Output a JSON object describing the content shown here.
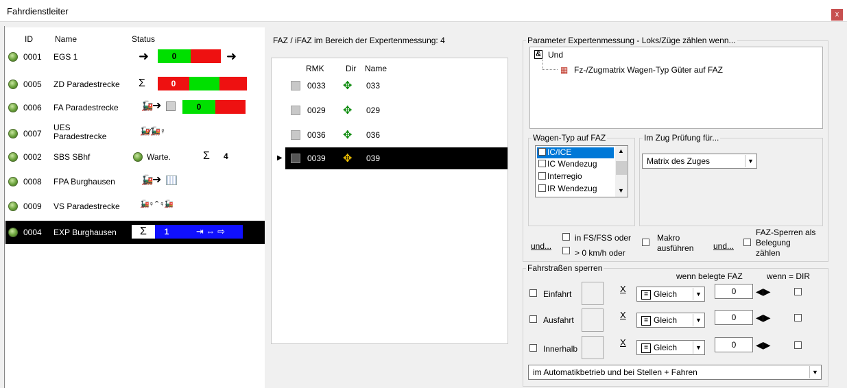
{
  "window": {
    "title": "Fahrdienstleiter",
    "close_label": "x"
  },
  "list": {
    "headers": {
      "id": "ID",
      "name": "Name",
      "status": "Status"
    },
    "rows": [
      {
        "id": "0001",
        "name": "EGS 1",
        "status_value": "0"
      },
      {
        "id": "0005",
        "name": "ZD Paradestrecke",
        "status_sym": "Σ",
        "status_value": "0"
      },
      {
        "id": "0006",
        "name": "FA Paradestrecke",
        "status_value": "0"
      },
      {
        "id": "0007",
        "name": "UES",
        "name2": "Paradestrecke"
      },
      {
        "id": "0002",
        "name": "SBS SBhf",
        "status_text": "Warte.",
        "status_sym": "Σ",
        "status_value": "4"
      },
      {
        "id": "0008",
        "name": "FPA Burghausen"
      },
      {
        "id": "0009",
        "name": "VS Paradestrecke"
      },
      {
        "id": "0004",
        "name": "EXP Burghausen",
        "status_sym": "Σ",
        "status_value": "1"
      }
    ]
  },
  "middle": {
    "header": "FAZ / iFAZ im Bereich der Expertenmessung: 4",
    "columns": {
      "rmk": "RMK",
      "dir": "Dir",
      "name": "Name"
    },
    "rows": [
      {
        "rmk": "0033",
        "name": "033"
      },
      {
        "rmk": "0029",
        "name": "029"
      },
      {
        "rmk": "0036",
        "name": "036"
      },
      {
        "rmk": "0039",
        "name": "039"
      }
    ]
  },
  "params": {
    "legend": "Parameter Expertenmessung - Loks/Züge zählen wenn...",
    "tree_root": "Und",
    "tree_child": "Fz-/Zugmatrix Wagen-Typ Güter auf FAZ"
  },
  "wagen": {
    "legend": "Wagen-Typ auf FAZ",
    "items": [
      "IC/ICE",
      "IC Wendezug",
      "Interregio",
      "IR Wendezug"
    ]
  },
  "imzug": {
    "legend": "Im Zug Prüfung für...",
    "value": "Matrix des Zuges"
  },
  "options": {
    "und1": "und...",
    "fs": "in FS/FSS oder",
    "kmh": "> 0 km/h oder",
    "makro1": "Makro",
    "makro2": "ausführen",
    "und2": "und...",
    "faz1": "FAZ-Sperren als",
    "faz2": "Belegung",
    "faz3": "zählen"
  },
  "fahr": {
    "legend": "Fahrstraßen sperren",
    "hdr_faz": "wenn belegte FAZ",
    "hdr_dir": "wenn = DIR",
    "rows": [
      {
        "label": "Einfahrt",
        "op": "Gleich",
        "value": "0"
      },
      {
        "label": "Ausfahrt",
        "op": "Gleich",
        "value": "0"
      },
      {
        "label": "Innerhalb",
        "op": "Gleich",
        "value": "0"
      }
    ],
    "mode": "im Automatikbetrieb und bei Stellen + Fahren"
  }
}
